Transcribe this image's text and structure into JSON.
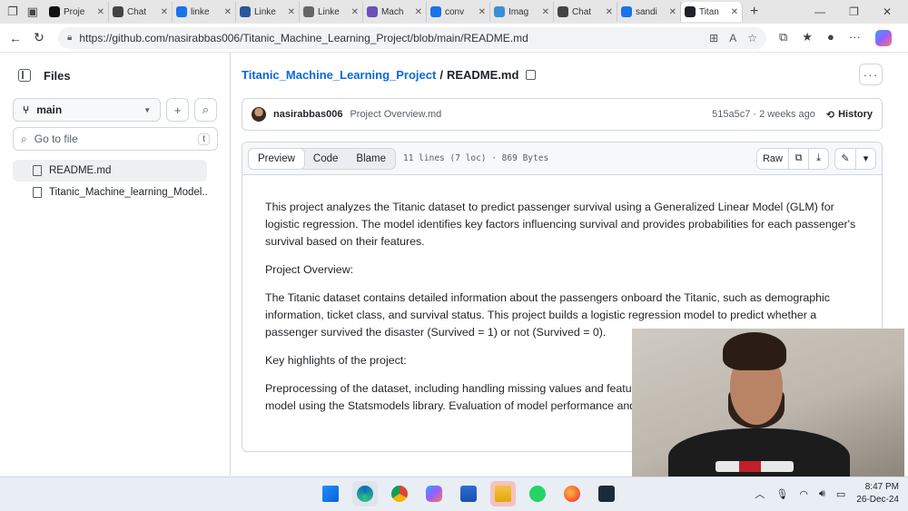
{
  "browser": {
    "tabs": [
      {
        "label": "Proje",
        "icon": "upwork-icon",
        "color": "#111111"
      },
      {
        "label": "Chat",
        "icon": "openai-icon",
        "color": "#444444"
      },
      {
        "label": "linke",
        "icon": "search-icon",
        "color": "#1a73e8"
      },
      {
        "label": "Linke",
        "icon": "word-icon",
        "color": "#2b579a"
      },
      {
        "label": "Linke",
        "icon": "x-icon",
        "color": "#666666"
      },
      {
        "label": "Mach",
        "icon": "app-icon",
        "color": "#6b4fbb"
      },
      {
        "label": "conv",
        "icon": "search-icon",
        "color": "#1a73e8"
      },
      {
        "label": "Imag",
        "icon": "image-icon",
        "color": "#3a8fd6"
      },
      {
        "label": "Chat",
        "icon": "openai-icon",
        "color": "#444444"
      },
      {
        "label": "sandi",
        "icon": "search-icon",
        "color": "#1a73e8"
      },
      {
        "label": "Titan",
        "icon": "github-icon",
        "color": "#1f2328",
        "active": true
      }
    ],
    "url": "https://github.com/nasirabbas006/Titanic_Machine_Learning_Project/blob/main/README.md"
  },
  "sidebar": {
    "title": "Files",
    "branch": "main",
    "goto_placeholder": "Go to file",
    "goto_shortcut": "t",
    "items": [
      {
        "label": "README.md",
        "selected": true
      },
      {
        "label": "Titanic_Machine_learning_Model...."
      }
    ]
  },
  "breadcrumb": {
    "repo": "Titanic_Machine_Learning_Project",
    "separator": "/",
    "file": "README.md"
  },
  "commit": {
    "author": "nasirabbas006",
    "message": "Project Overview.md",
    "hash_time": "515a5c7 · 2 weeks ago",
    "history_label": "History"
  },
  "file_header": {
    "tabs": [
      "Preview",
      "Code",
      "Blame"
    ],
    "active_tab": "Preview",
    "info": "11 lines (7 loc) · 869 Bytes",
    "raw_label": "Raw"
  },
  "readme": {
    "p1": "This project analyzes the Titanic dataset to predict passenger survival using a Generalized Linear Model (GLM) for logistic regression. The model identifies key factors influencing survival and provides probabilities for each passenger's survival based on their features.",
    "p2": "Project Overview:",
    "p3": "The Titanic dataset contains detailed information about the passengers onboard the Titanic, such as demographic information, ticket class, and survival status. This project builds a logistic regression model to predict whether a passenger survived the disaster (Survived = 1) or not (Survived = 0).",
    "p4": "Key highlights of the project:",
    "p5": "Preprocessing of the dataset, including handling missing values and feature engineering. Building a logistic regression model using the Statsmodels library. Evaluation of model performance and interpretation of feature importance."
  },
  "taskbar": {
    "time": "8:47 PM",
    "date": "26-Dec-24"
  }
}
